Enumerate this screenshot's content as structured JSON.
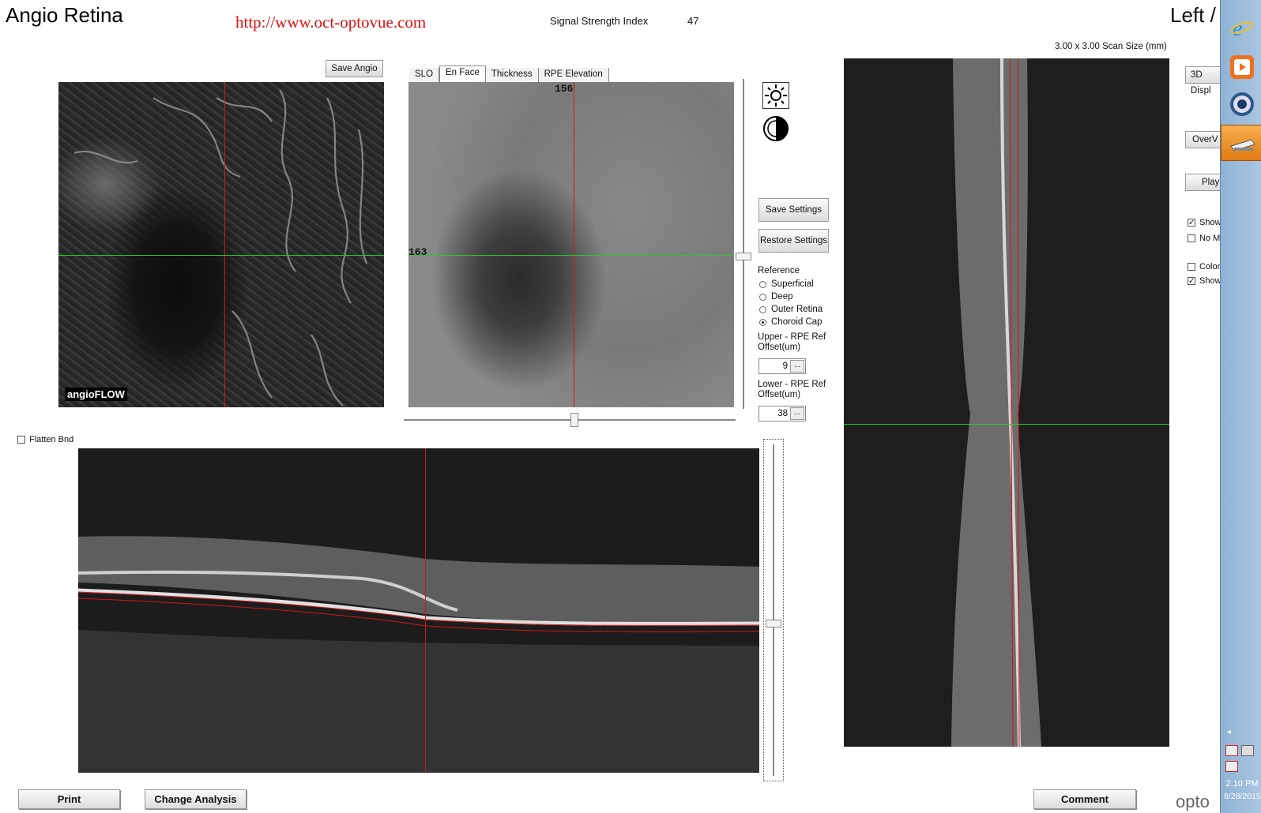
{
  "header": {
    "title": "Angio Retina",
    "url": "http://www.oct-optovue.com",
    "signal_strength_label": "Signal Strength Index",
    "signal_strength_value": "47",
    "eye_label": "Left /",
    "scan_size": "3.00 x 3.00 Scan Size (mm)"
  },
  "angio_panel": {
    "save_label": "Save Angio",
    "logo_text": "angioFLOW"
  },
  "enface_panel": {
    "tabs": [
      "SLO",
      "En Face",
      "Thickness",
      "RPE Elevation"
    ],
    "active_tab": "En Face",
    "top_marker": "156",
    "left_marker": "163"
  },
  "settings": {
    "save_label": "Save Settings",
    "restore_label": "Restore Settings",
    "reference_label": "Reference",
    "reference_options": [
      "Superficial",
      "Deep",
      "Outer Retina",
      "Choroid Cap"
    ],
    "selected_reference": "Choroid Cap",
    "upper_label": "Upper - RPE Ref Offset(um)",
    "upper_value": "9",
    "lower_label": "Lower - RPE Ref Offset(um)",
    "lower_value": "38",
    "ellipsis": "..."
  },
  "bscan": {
    "flatten_label": "Flatten Bnd",
    "flatten_checked": false
  },
  "right_panel": {
    "display_3d_label": "3D Displ",
    "overview_label": "OverV",
    "play_label": "Play",
    "checkboxes": [
      {
        "label": "Show",
        "checked": true
      },
      {
        "label": "No M",
        "checked": false
      },
      {
        "label": "Color",
        "checked": false
      },
      {
        "label": "Show",
        "checked": true
      }
    ]
  },
  "footer": {
    "print_label": "Print",
    "change_analysis_label": "Change Analysis",
    "comment_label": "Comment",
    "brand_text": "opto"
  },
  "taskbar": {
    "time": "2:10 PM",
    "date": "8/28/2015"
  },
  "colors": {
    "red_line": "#d01818",
    "green_line": "#22cc22",
    "url_red": "#e01010"
  }
}
